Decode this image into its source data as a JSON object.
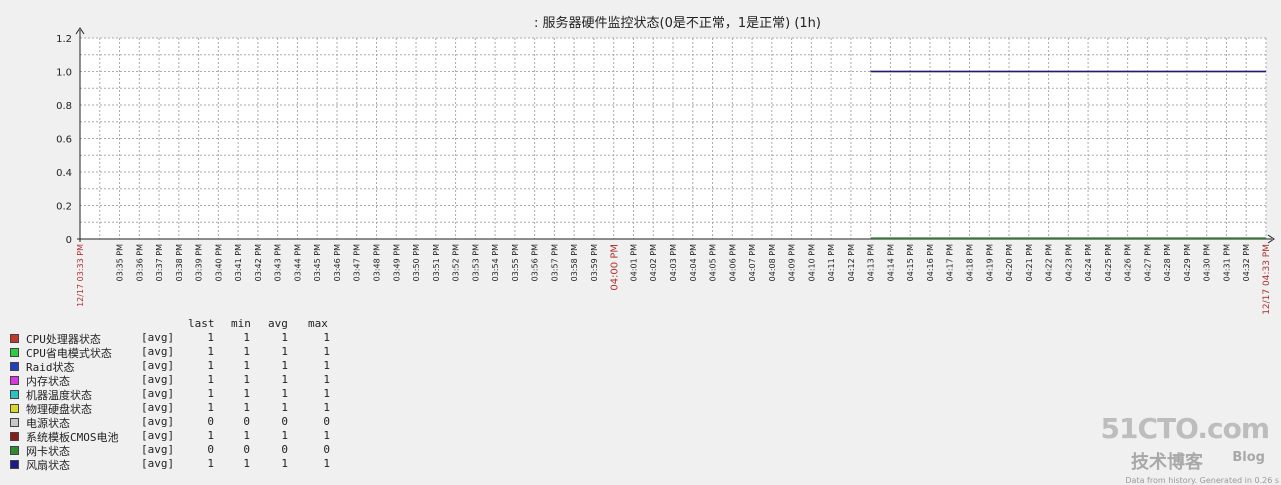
{
  "chart_data": {
    "type": "line",
    "title": ": 服务器硬件监控状态(0是不正常，1是正常) (1h)",
    "y_ticks": [
      "0",
      "0.2",
      "0.4",
      "0.6",
      "0.8",
      "1.0",
      "1.2"
    ],
    "ylim": [
      0,
      1.2
    ],
    "x_start_label": "12/17 03:33 PM",
    "x_mid_label": "04:00 PM",
    "x_end_label": "12/17 04:33 PM",
    "x_tick_labels": [
      "03:35 PM",
      "03:36 PM",
      "03:37 PM",
      "03:38 PM",
      "03:39 PM",
      "03:40 PM",
      "03:41 PM",
      "03:42 PM",
      "03:43 PM",
      "03:44 PM",
      "03:45 PM",
      "03:46 PM",
      "03:47 PM",
      "03:48 PM",
      "03:49 PM",
      "03:50 PM",
      "03:51 PM",
      "03:52 PM",
      "03:53 PM",
      "03:54 PM",
      "03:55 PM",
      "03:56 PM",
      "03:57 PM",
      "03:58 PM",
      "03:59 PM",
      "04:00 PM",
      "04:01 PM",
      "04:02 PM",
      "04:03 PM",
      "04:04 PM",
      "04:05 PM",
      "04:06 PM",
      "04:07 PM",
      "04:08 PM",
      "04:09 PM",
      "04:10 PM",
      "04:11 PM",
      "04:12 PM",
      "04:13 PM",
      "04:14 PM",
      "04:15 PM",
      "04:16 PM",
      "04:17 PM",
      "04:18 PM",
      "04:19 PM",
      "04:20 PM",
      "04:21 PM",
      "04:22 PM",
      "04:23 PM",
      "04:24 PM",
      "04:25 PM",
      "04:26 PM",
      "04:27 PM",
      "04:28 PM",
      "04:29 PM",
      "04:30 PM",
      "04:31 PM",
      "04:32 PM"
    ],
    "x_range_minutes": [
      0,
      60
    ],
    "grid": true,
    "series": [
      {
        "name": "CPU处理器状态",
        "color": "#c0392b",
        "segment_start_minute": 40,
        "segment_end_minute": 60,
        "value": 1
      },
      {
        "name": "CPU省电模式状态",
        "color": "#2ecc40",
        "segment_start_minute": 40,
        "segment_end_minute": 60,
        "value": 1
      },
      {
        "name": "Raid状态",
        "color": "#1f3fbf",
        "segment_start_minute": 40,
        "segment_end_minute": 60,
        "value": 1
      },
      {
        "name": "内存状态",
        "color": "#d63adf",
        "segment_start_minute": 40,
        "segment_end_minute": 60,
        "value": 1
      },
      {
        "name": "机器温度状态",
        "color": "#2bc4c4",
        "segment_start_minute": 40,
        "segment_end_minute": 60,
        "value": 1
      },
      {
        "name": "物理硬盘状态",
        "color": "#d9d92b",
        "segment_start_minute": 40,
        "segment_end_minute": 60,
        "value": 1
      },
      {
        "name": "电源状态",
        "color": "#c8c8c8",
        "segment_start_minute": 40,
        "segment_end_minute": 60,
        "value": 0
      },
      {
        "name": "系统模板CMOS电池",
        "color": "#8b1a1a",
        "segment_start_minute": 40,
        "segment_end_minute": 60,
        "value": 1
      },
      {
        "name": "网卡状态",
        "color": "#2e8b2e",
        "segment_start_minute": 40,
        "segment_end_minute": 60,
        "value": 0
      },
      {
        "name": "风扇状态",
        "color": "#1a1a8b",
        "segment_start_minute": 40,
        "segment_end_minute": 60,
        "value": 1
      }
    ]
  },
  "legend": {
    "headers": {
      "last": "last",
      "min": "min",
      "avg": "avg",
      "max": "max"
    },
    "rows": [
      {
        "name": "CPU处理器状态",
        "func": "[avg]",
        "last": "1",
        "min": "1",
        "avg": "1",
        "max": "1"
      },
      {
        "name": "CPU省电模式状态",
        "func": "[avg]",
        "last": "1",
        "min": "1",
        "avg": "1",
        "max": "1"
      },
      {
        "name": "Raid状态",
        "func": "[avg]",
        "last": "1",
        "min": "1",
        "avg": "1",
        "max": "1"
      },
      {
        "name": "内存状态",
        "func": "[avg]",
        "last": "1",
        "min": "1",
        "avg": "1",
        "max": "1"
      },
      {
        "name": "机器温度状态",
        "func": "[avg]",
        "last": "1",
        "min": "1",
        "avg": "1",
        "max": "1"
      },
      {
        "name": "物理硬盘状态",
        "func": "[avg]",
        "last": "1",
        "min": "1",
        "avg": "1",
        "max": "1"
      },
      {
        "name": "电源状态",
        "func": "[avg]",
        "last": "0",
        "min": "0",
        "avg": "0",
        "max": "0"
      },
      {
        "name": "系统模板CMOS电池",
        "func": "[avg]",
        "last": "1",
        "min": "1",
        "avg": "1",
        "max": "1"
      },
      {
        "name": "网卡状态",
        "func": "[avg]",
        "last": "0",
        "min": "0",
        "avg": "0",
        "max": "0"
      },
      {
        "name": "风扇状态",
        "func": "[avg]",
        "last": "1",
        "min": "1",
        "avg": "1",
        "max": "1"
      }
    ]
  },
  "watermark": {
    "logo": "51CTO.com",
    "subtitle": "技术博客",
    "blog": "Blog"
  },
  "footer": "Data from history. Generated in 0.26 s"
}
